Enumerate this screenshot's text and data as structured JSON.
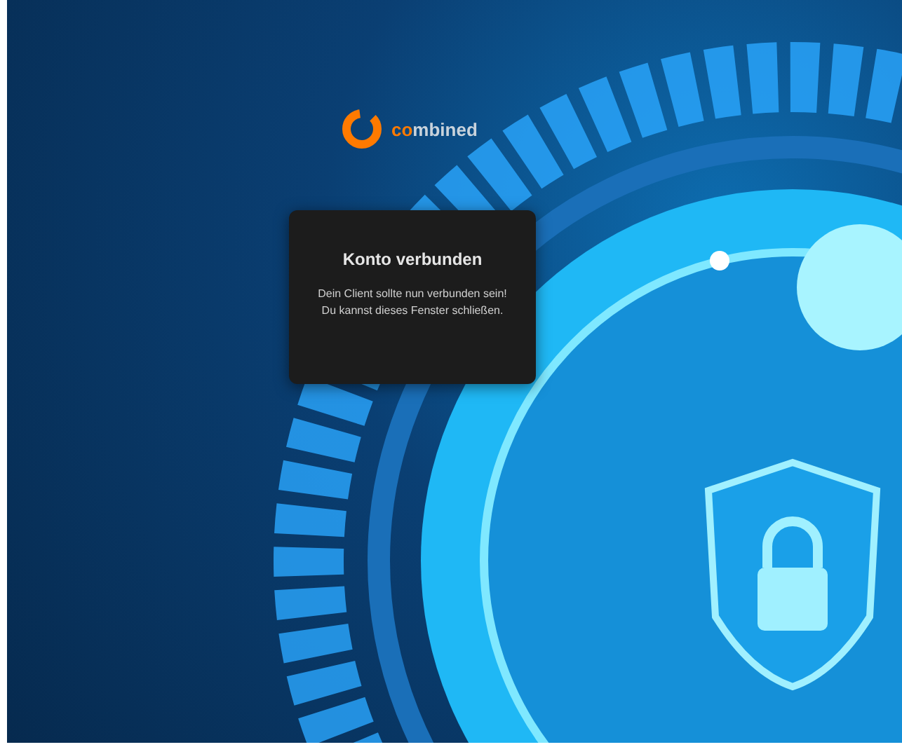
{
  "logo": {
    "accent": "co",
    "rest": "mbined"
  },
  "dialog": {
    "title": "Konto verbunden",
    "lines": [
      "Dein Client sollte nun verbunden sein!",
      "Du kannst dieses Fenster schließen."
    ]
  }
}
